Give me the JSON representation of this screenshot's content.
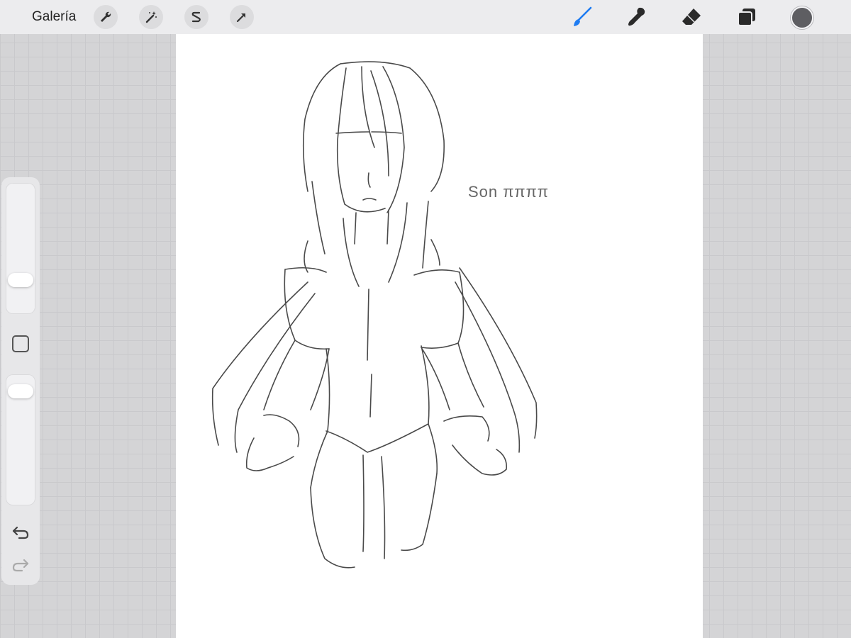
{
  "toolbar": {
    "gallery_label": "Galería",
    "left_tools": [
      "wrench-icon",
      "magic-wand-icon",
      "selection-s-icon",
      "arrow-transform-icon"
    ],
    "right_tools": [
      "brush-icon",
      "smudge-icon",
      "eraser-icon",
      "layers-icon"
    ],
    "active_tool": "brush",
    "active_tool_color": "#1e7cf2",
    "current_color": "#5e5e62"
  },
  "side_panel": {
    "brush_size_level": 0.22,
    "opacity_level": 0.93,
    "modify_icon": "square-icon",
    "undo_icon": "undo-icon",
    "redo_icon": "redo-icon"
  },
  "canvas": {
    "annotation_text": "Son ππππ",
    "background": "#ffffff",
    "stroke_color": "#4a4a4a"
  }
}
